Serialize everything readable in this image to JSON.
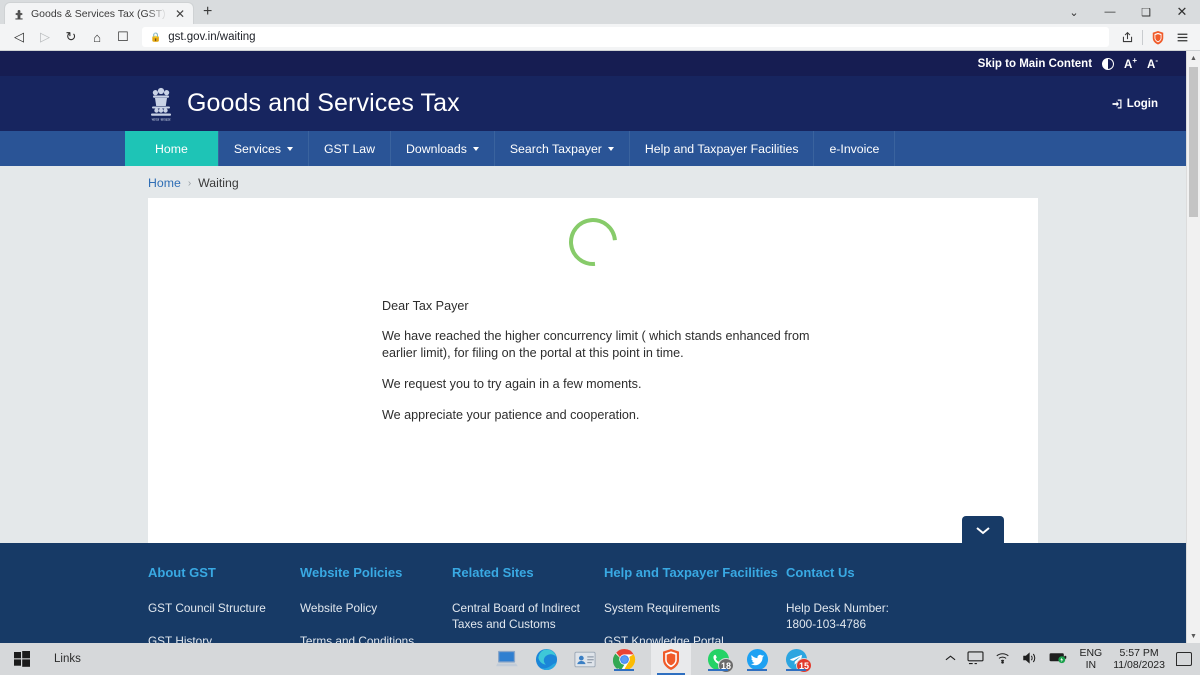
{
  "browser": {
    "tab": {
      "title": "Goods & Services Tax (GST) | Web",
      "close_label": "✕",
      "favicon": "india-emblem-favicon"
    },
    "newtab_label": "+",
    "window_controls": {
      "restore_list": "⌄",
      "minimize": "—",
      "maximize": "❑",
      "close": "✕"
    },
    "nav": {
      "back": "◁",
      "forward": "▷",
      "reload": "↻",
      "home": "⌂",
      "bookmark": "☐"
    },
    "url": "gst.gov.in/waiting",
    "lock_icon": "padlock-icon",
    "share_icon": "share-icon",
    "shield_icon": "brave-shield-icon",
    "menu_icon": "hamburger-menu-icon"
  },
  "site": {
    "accessibility": {
      "skip_label": "Skip to Main Content",
      "contrast_label": "contrast-toggle-icon",
      "font_increase": "A",
      "font_increase_sup": "+",
      "font_decrease": "A",
      "font_decrease_sup": "-"
    },
    "header": {
      "emblem_alt": "india-national-emblem",
      "title": "Goods and Services Tax",
      "login_label": "Login",
      "login_icon": "login-arrow-icon"
    },
    "nav_items": [
      {
        "label": "Home",
        "has_caret": false,
        "active": true
      },
      {
        "label": "Services",
        "has_caret": true,
        "active": false
      },
      {
        "label": "GST Law",
        "has_caret": false,
        "active": false
      },
      {
        "label": "Downloads",
        "has_caret": true,
        "active": false
      },
      {
        "label": "Search Taxpayer",
        "has_caret": true,
        "active": false
      },
      {
        "label": "Help and Taxpayer Facilities",
        "has_caret": false,
        "active": false
      },
      {
        "label": "e-Invoice",
        "has_caret": false,
        "active": false
      }
    ],
    "breadcrumb": {
      "home": "Home",
      "separator": "›",
      "current": "Waiting"
    },
    "content": {
      "spinner_label": "loading-spinner",
      "greeting": "Dear Tax Payer",
      "paragraphs": [
        "We have reached the higher concurrency limit ( which stands enhanced from earlier limit), for filing on the portal at this point in time.",
        "We request you to try again in a few moments.",
        "We appreciate your patience and cooperation."
      ]
    },
    "scroll_down_button": "chevron-down-icon",
    "footer": {
      "columns": [
        {
          "heading": "About GST",
          "links": [
            "GST Council Structure",
            "GST History"
          ]
        },
        {
          "heading": "Website Policies",
          "links": [
            "Website Policy",
            "Terms and Conditions"
          ]
        },
        {
          "heading": "Related Sites",
          "links": [
            "Central Board of Indirect Taxes and Customs"
          ]
        },
        {
          "heading": "Help and Taxpayer Facilities",
          "links": [
            "System Requirements",
            "GST Knowledge Portal"
          ]
        },
        {
          "heading": "Contact Us",
          "lines": [
            "Help Desk Number:",
            "1800-103-4786"
          ]
        }
      ]
    }
  },
  "taskbar": {
    "start_label": "windows-start-icon",
    "links_label": "Links",
    "apps": [
      {
        "name": "remote-desktop-icon",
        "badge": null
      },
      {
        "name": "microsoft-edge-icon",
        "badge": null
      },
      {
        "name": "contacts-icon",
        "badge": null
      },
      {
        "name": "google-chrome-icon",
        "badge": null
      },
      {
        "name": "brave-browser-icon",
        "badge": null
      },
      {
        "name": "whatsapp-icon",
        "badge": "18"
      },
      {
        "name": "twitter-icon",
        "badge": null
      },
      {
        "name": "telegram-icon",
        "badge": "15"
      }
    ],
    "tray": {
      "show_hidden": "chevron-up-icon",
      "network_icon": "monitor-network-icon",
      "wifi_icon": "wifi-icon",
      "volume_icon": "speaker-icon",
      "battery_icon": "battery-charging-icon",
      "language_line1": "ENG",
      "language_line2": "IN",
      "time": "5:57 PM",
      "date": "11/08/2023",
      "action_center": "notification-icon"
    }
  }
}
